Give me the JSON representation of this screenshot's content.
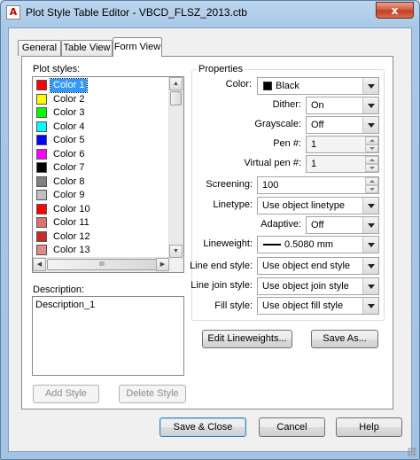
{
  "window": {
    "title": "Plot Style Table Editor - VBCD_FLSZ_2013.ctb",
    "app_icon_glyph": "A",
    "close_glyph": "x"
  },
  "tabs": [
    {
      "label": "General"
    },
    {
      "label": "Table View"
    },
    {
      "label": "Form View"
    }
  ],
  "plot_styles": {
    "label": "Plot styles:",
    "items": [
      {
        "label": "Color 1",
        "color": "#ff0000"
      },
      {
        "label": "Color 2",
        "color": "#ffff00"
      },
      {
        "label": "Color 3",
        "color": "#00ff00"
      },
      {
        "label": "Color 4",
        "color": "#00ffff"
      },
      {
        "label": "Color 5",
        "color": "#0000ff"
      },
      {
        "label": "Color 6",
        "color": "#ff00ff"
      },
      {
        "label": "Color 7",
        "color": "#000000"
      },
      {
        "label": "Color 8",
        "color": "#808080"
      },
      {
        "label": "Color 9",
        "color": "#c0c0c0"
      },
      {
        "label": "Color 10",
        "color": "#ff0000"
      },
      {
        "label": "Color 11",
        "color": "#e07070"
      },
      {
        "label": "Color 12",
        "color": "#cc2a2a"
      },
      {
        "label": "Color 13",
        "color": "#e28888"
      }
    ],
    "hscroll_grip": "III"
  },
  "description": {
    "label": "Description:",
    "value": "Description_1"
  },
  "buttons": {
    "add_style": "Add Style",
    "delete_style": "Delete Style",
    "edit_lineweights": "Edit Lineweights...",
    "save_as": "Save As...",
    "save_close": "Save & Close",
    "cancel": "Cancel",
    "help": "Help"
  },
  "properties": {
    "title": "Properties",
    "color": {
      "label": "Color:",
      "value": "Black",
      "swatch": "#000000"
    },
    "dither": {
      "label": "Dither:",
      "value": "On"
    },
    "grayscale": {
      "label": "Grayscale:",
      "value": "Off"
    },
    "pen": {
      "label": "Pen #:",
      "value": "1"
    },
    "virtual_pen": {
      "label": "Virtual pen #:",
      "value": "1"
    },
    "screening": {
      "label": "Screening:",
      "value": "100"
    },
    "linetype": {
      "label": "Linetype:",
      "value": "Use object linetype"
    },
    "adaptive": {
      "label": "Adaptive:",
      "value": "Off"
    },
    "lineweight": {
      "label": "Lineweight:",
      "value": "0.5080 mm"
    },
    "line_end_style": {
      "label": "Line end style:",
      "value": "Use object end style"
    },
    "line_join_style": {
      "label": "Line join style:",
      "value": "Use object join style"
    },
    "fill_style": {
      "label": "Fill style:",
      "value": "Use object fill style"
    }
  }
}
